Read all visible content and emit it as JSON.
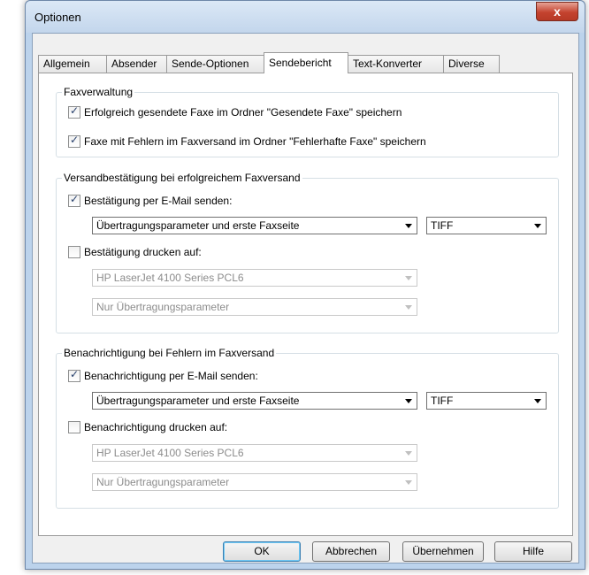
{
  "window": {
    "title": "Optionen",
    "close_label": "x"
  },
  "tabs": [
    {
      "label": "Allgemein"
    },
    {
      "label": "Absender"
    },
    {
      "label": "Sende-Optionen"
    },
    {
      "label": "Sendebericht"
    },
    {
      "label": "Text-Konverter"
    },
    {
      "label": "Diverse"
    }
  ],
  "faxverwaltung": {
    "title": "Faxverwaltung",
    "option1": "Erfolgreich gesendete Faxe im Ordner \"Gesendete Faxe\" speichern",
    "option2": "Faxe mit Fehlern im Faxversand im Ordner \"Fehlerhafte Faxe\" speichern"
  },
  "versand": {
    "title": "Versandbestätigung bei erfolgreichem Faxversand",
    "email_label": "Bestätigung per E-Mail senden:",
    "email_content": "Übertragungsparameter und erste Faxseite",
    "email_format": "TIFF",
    "print_label": "Bestätigung drucken auf:",
    "printer": "HP LaserJet 4100 Series PCL6",
    "print_content": "Nur Übertragungsparameter"
  },
  "fehler": {
    "title": "Benachrichtigung bei Fehlern im Faxversand",
    "email_label": "Benachrichtigung per E-Mail senden:",
    "email_content": "Übertragungsparameter und erste Faxseite",
    "email_format": "TIFF",
    "print_label": "Benachrichtigung drucken auf:",
    "printer": "HP LaserJet 4100 Series PCL6",
    "print_content": "Nur Übertragungsparameter"
  },
  "buttons": {
    "ok": "OK",
    "cancel": "Abbrechen",
    "apply": "Übernehmen",
    "help": "Hilfe"
  },
  "checkmark": "✓"
}
